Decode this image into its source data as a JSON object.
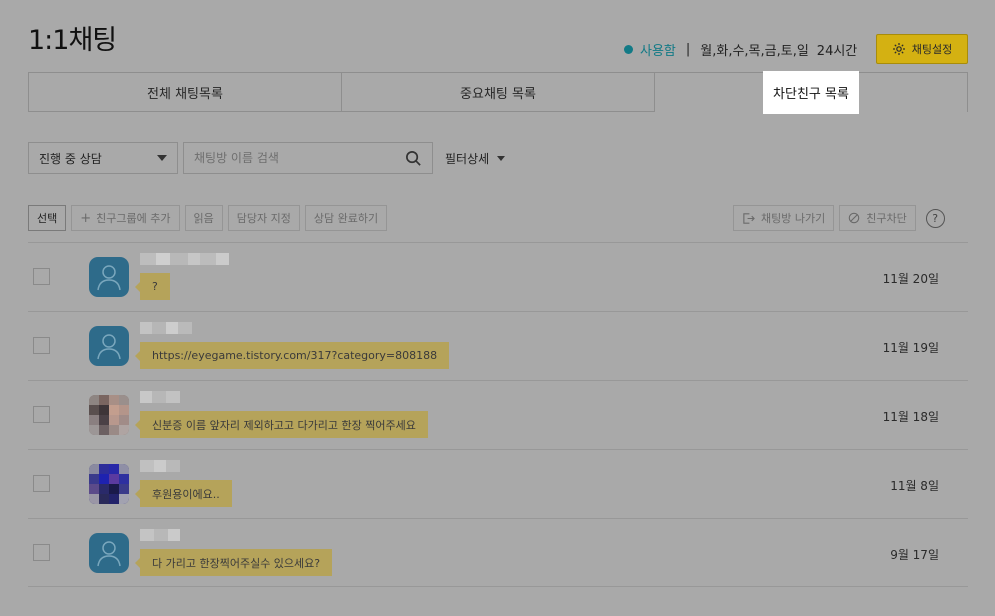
{
  "header": {
    "title": "1:1채팅",
    "status_label": "사용함",
    "separator": "|",
    "days": "월,화,수,목,금,토,일",
    "hours": "24시간",
    "settings_label": "채팅설정"
  },
  "tabs": [
    {
      "label": "전체 채팅목록"
    },
    {
      "label": "중요채팅 목록"
    },
    {
      "label": "차단친구 목록",
      "active": true
    }
  ],
  "filters": {
    "status_select_value": "진행 중 상담",
    "search_placeholder": "채팅방 이름 검색",
    "filter_detail_label": "필터상세"
  },
  "toolbar": {
    "select_label": "선택",
    "add_group_label": "친구그룹에 추가",
    "read_label": "읽음",
    "assign_label": "담당자 지정",
    "complete_label": "상담 완료하기",
    "leave_label": "채팅방 나가기",
    "block_label": "친구차단",
    "help_label": "?"
  },
  "chats": [
    {
      "avatar": "default",
      "message": "?",
      "date": "11월 20일"
    },
    {
      "avatar": "default",
      "message": "https://eyegame.tistory.com/317?category=808188",
      "date": "11월 19일"
    },
    {
      "avatar": "photo-skin",
      "message": "신분증 이름 앞자리 제외하고고 다가리고 한장 찍어주세요",
      "date": "11월 18일"
    },
    {
      "avatar": "photo-blue",
      "message": "후원용이에요..",
      "date": "11월 8일"
    },
    {
      "avatar": "default",
      "message": "다 가리고 한장찍어주실수 있으세요?",
      "date": "9월 17일"
    }
  ],
  "colors": {
    "accent_teal": "#127a86",
    "settings_button": "#d4b112",
    "bubble": "#b5a35a",
    "overlay": "#a9a9a9",
    "default_avatar": "#2e6b8a"
  }
}
